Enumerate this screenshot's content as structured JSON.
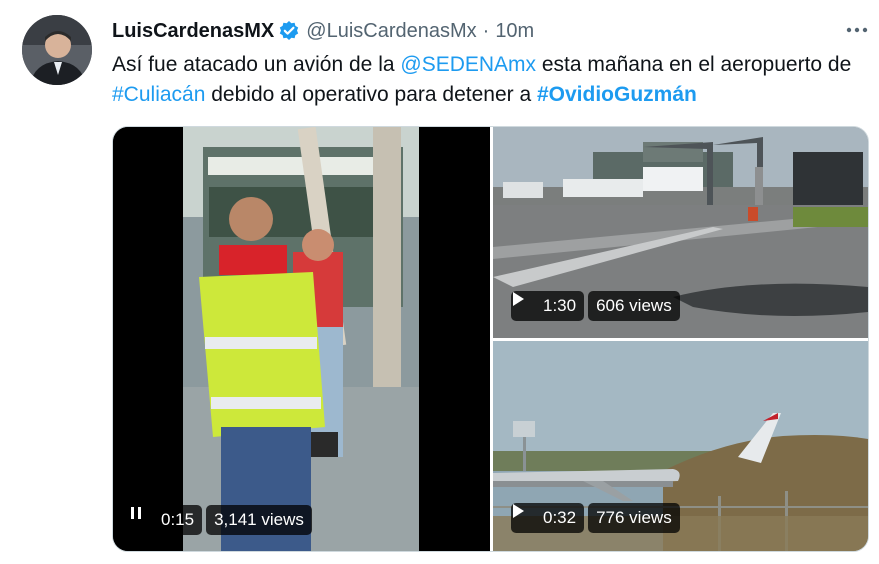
{
  "tweet": {
    "display_name": "LuisCardenasMX",
    "handle": "@LuisCardenasMx",
    "separator": "·",
    "time": "10m",
    "text": {
      "p1": "Así fue atacado un avión de la ",
      "mention": "@SEDENAmx",
      "p2": " esta mañana en el aeropuerto de ",
      "hashtag1": "#Culiacán",
      "p3": " debido al operativo para detener a ",
      "hashtag2": "#OvidioGuzmán"
    }
  },
  "media": [
    {
      "state": "playing",
      "duration": "0:15",
      "views": "3,141 views"
    },
    {
      "state": "paused",
      "duration": "1:30",
      "views": "606 views"
    },
    {
      "state": "paused",
      "duration": "0:32",
      "views": "776 views"
    }
  ],
  "icons": {
    "verified": "verified-badge-icon",
    "more": "more-options-icon",
    "play": "play-icon",
    "pause": "pause-icon"
  },
  "colors": {
    "link": "#1d9bf0",
    "text": "#0f1419",
    "secondary": "#536471"
  }
}
